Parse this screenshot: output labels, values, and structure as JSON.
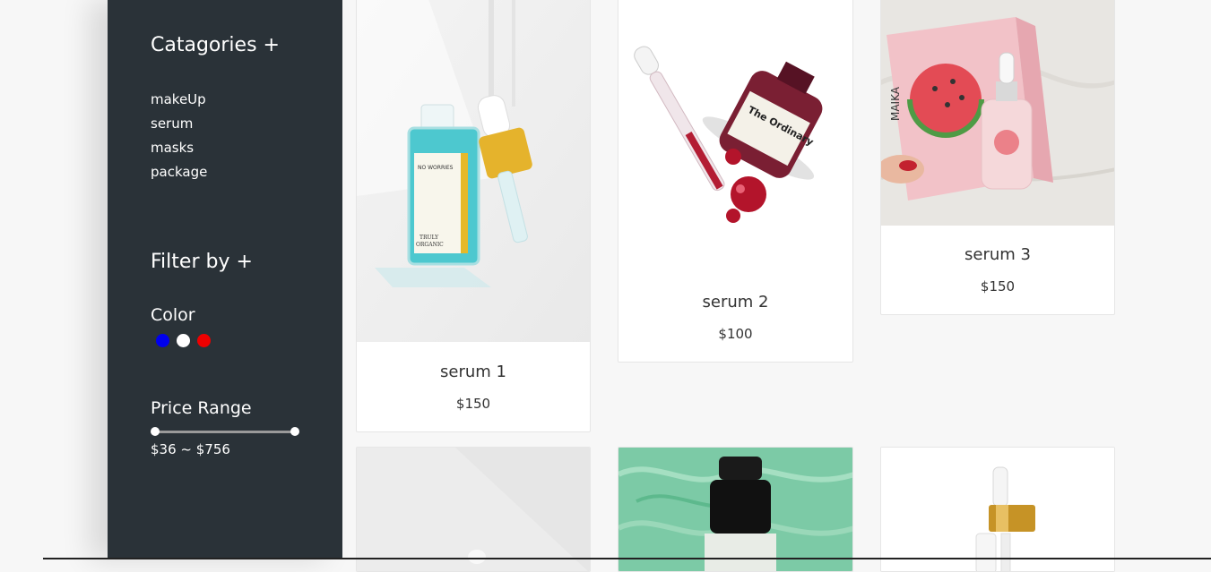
{
  "sidebar": {
    "categories_title": "Catagories +",
    "categories": [
      "makeUp",
      "serum",
      "masks",
      "package"
    ],
    "filter_title": "Filter by +",
    "color_label": "Color",
    "colors": [
      "#0000ee",
      "#ffffff",
      "#ee0000"
    ],
    "price_label": "Price Range",
    "price_range_text": "$36 ~ $756"
  },
  "products": [
    {
      "name": "serum 1",
      "price": "$150"
    },
    {
      "name": "serum 2",
      "price": "$100"
    },
    {
      "name": "serum 3",
      "price": "$150"
    }
  ],
  "colors": {
    "sidebar_bg": "#2a3238",
    "page_bg": "#f7f7f7"
  }
}
